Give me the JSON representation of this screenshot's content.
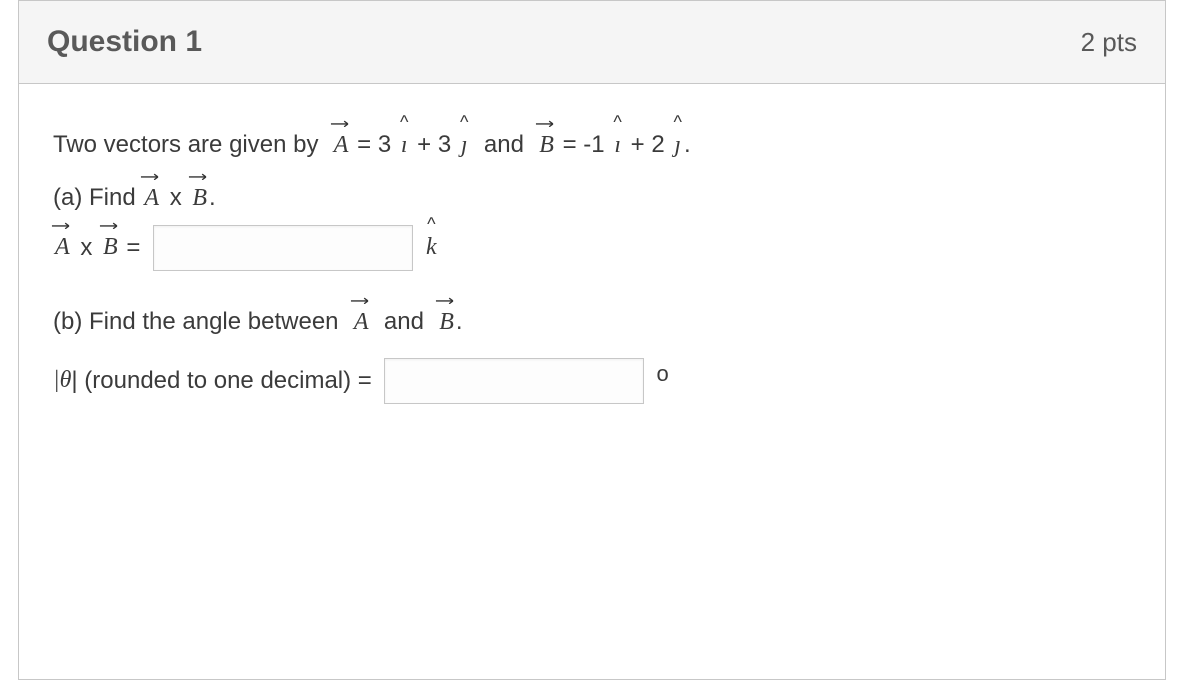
{
  "header": {
    "title": "Question 1",
    "points": "2 pts"
  },
  "body": {
    "intro_prefix": "Two vectors are given by  ",
    "eqA_lhs": "A",
    "eqA_rhs_pre": " = 3 ",
    "eqA_rhs_mid": " + 3 ",
    "intro_and": "  and  ",
    "eqB_lhs": "B",
    "eqB_rhs_pre": " = -1 ",
    "eqB_rhs_mid": " + 2 ",
    "period": ".",
    "partA_label": "(a) Find ",
    "cross_times": " x ",
    "partA_period": ".",
    "crossExpr_lhs_A": "A",
    "crossExpr_times": " x ",
    "crossExpr_lhs_B": "B",
    "crossExpr_eq": " = ",
    "khat": "k",
    "partB_label": "(b) Find the angle between  ",
    "partB_and": "  and  ",
    "partB_period": ".",
    "theta_label_pre": "|",
    "theta_symbol": "θ",
    "theta_label_post": "| (rounded to one decimal) = ",
    "degree": "o",
    "ihat": "ı",
    "jhat": "ȷ",
    "vecA": "A",
    "vecB": "B"
  }
}
